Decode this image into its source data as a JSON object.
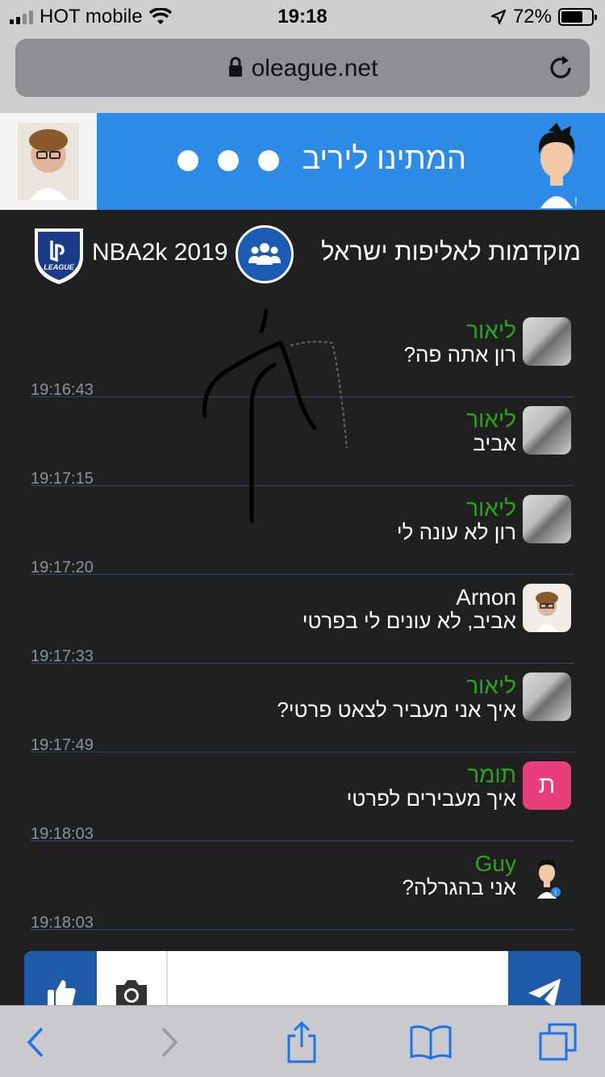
{
  "status_bar": {
    "carrier": "HOT mobile",
    "time": "19:18",
    "battery_percent": "72%",
    "battery_level": 0.72
  },
  "browser": {
    "url": "oleague.net"
  },
  "banner": {
    "waiting_text": "המתינו ליריב"
  },
  "league": {
    "name": "מוקדמות לאליפות ישראל",
    "game": "NBA2k 2019",
    "logo_text": "LEAGUE"
  },
  "messages": [
    {
      "name": "ליאור",
      "text": "רון אתה פה?",
      "time": "19:16:43",
      "avatar": "photo"
    },
    {
      "name": "ליאור",
      "text": "אביב",
      "time": "19:17:15",
      "avatar": "photo"
    },
    {
      "name": "ליאור",
      "text": "רון לא עונה לי",
      "time": "19:17:20",
      "avatar": "photo"
    },
    {
      "name": "Arnon",
      "text": "אביב, לא עונים לי בפרטי",
      "time": "19:17:33",
      "avatar": "filter-photo"
    },
    {
      "name": "ליאור",
      "text": "איך אני מעביר לצאט פרטי?",
      "time": "19:17:49",
      "avatar": "photo"
    },
    {
      "name": "תומר",
      "text": "איך מעבירים לפרטי",
      "time": "19:18:03",
      "avatar": "letter",
      "avatar_letter": "ת"
    },
    {
      "name": "Guy",
      "text": "אני בהגרלה?",
      "time": "19:18:03",
      "avatar": "default-avatar"
    }
  ],
  "input": {
    "placeholder": ""
  },
  "colors": {
    "accent_blue": "#2b8be6",
    "dark_blue": "#1e5aa8",
    "name_green": "#2ea31e",
    "background": "#202020"
  }
}
